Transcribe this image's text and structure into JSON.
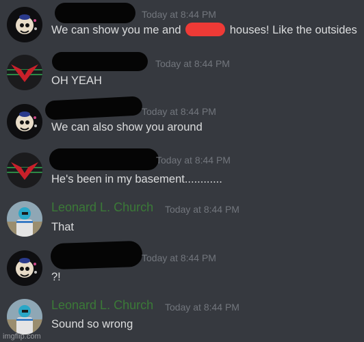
{
  "messages": [
    {
      "author": "",
      "timestamp": "Today at 8:44 PM",
      "text_before": "We can show you me and ",
      "text_after": " houses! Like the outsides"
    },
    {
      "author": "",
      "timestamp": "Today at 8:44 PM",
      "text": "OH YEAH"
    },
    {
      "author": "",
      "timestamp": "Today at 8:44 PM",
      "text": "We can also show you around"
    },
    {
      "author": "",
      "timestamp": "Today at 8:44 PM",
      "text": "He's been in my basement............"
    },
    {
      "author": "Leonard L. Church",
      "timestamp": "Today at 8:44 PM",
      "text": "That"
    },
    {
      "author": "",
      "timestamp": "Today at 8:44 PM",
      "text": "?!"
    },
    {
      "author": "Leonard L. Church",
      "timestamp": "Today at 8:44 PM",
      "text": "Sound so wrong"
    }
  ],
  "colors": {
    "background": "#36393f",
    "message_text": "#dcddde",
    "timestamp": "#72767d",
    "leonard_name": "#3b7a37",
    "redaction": "#050505",
    "red_redaction": "#ee3a36"
  },
  "watermark": "imgflip.com"
}
